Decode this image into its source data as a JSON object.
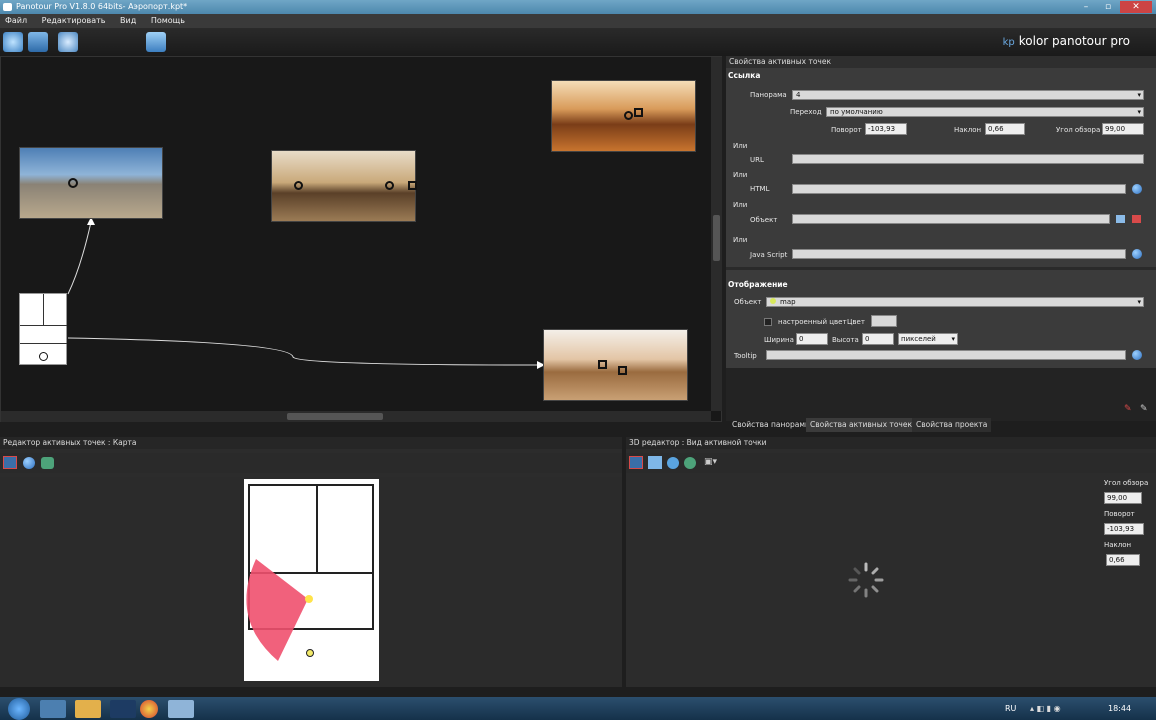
{
  "window": {
    "title": "Panotour Pro V1.8.0 64bits- Аэропорт.kpt*"
  },
  "menu": {
    "items": [
      "Файл",
      "Редактировать",
      "Вид",
      "Помощь"
    ]
  },
  "brand": {
    "text": "kolor panotour pro",
    "logo": "kp"
  },
  "right_panel": {
    "title": "Свойства активных точек",
    "link_section": "Ссылка",
    "panorama_label": "Панорама",
    "panorama_value": "4",
    "transition_label": "Переход",
    "transition_value": "по умолчанию",
    "rotation_label": "Поворот",
    "rotation_value": "-103,93",
    "tilt_label": "Наклон",
    "tilt_value": "0,66",
    "fov_label": "Угол обзора",
    "fov_value": "99,00",
    "or1": "Или",
    "url_label": "URL",
    "or2": "Или",
    "html_label": "HTML",
    "or3": "Или",
    "object_label": "Объект",
    "or4": "Или",
    "js_label": "Java Script",
    "display_section": "Отображение",
    "display_object_label": "Объект",
    "display_object_value": "map",
    "custom_color_label": "настроенный цвет",
    "color_label": "Цвет",
    "width_label": "Ширина",
    "width_value": "0",
    "height_label": "Высота",
    "height_value": "0",
    "unit_value": "пикселей",
    "tooltip_label": "Tooltip"
  },
  "tabs": [
    "Свойства панорамы",
    "Свойства активных точек",
    "Свойства проекта"
  ],
  "bottom_left": {
    "title": "Редактор активных точек : Карта"
  },
  "bottom_right": {
    "title": "3D редактор : Вид активной точки",
    "fov_label": "Угол обзора",
    "fov_value": "99,00",
    "rotation_label": "Поворот",
    "rotation_value": "-103,93",
    "tilt_label": "Наклон",
    "tilt_value": "0,66"
  },
  "taskbar": {
    "lang": "RU",
    "time": "18:44"
  },
  "colors": {
    "accent": "#6aa8e0",
    "fov_cone": "#f0506e",
    "panel": "#3b3b3b"
  }
}
